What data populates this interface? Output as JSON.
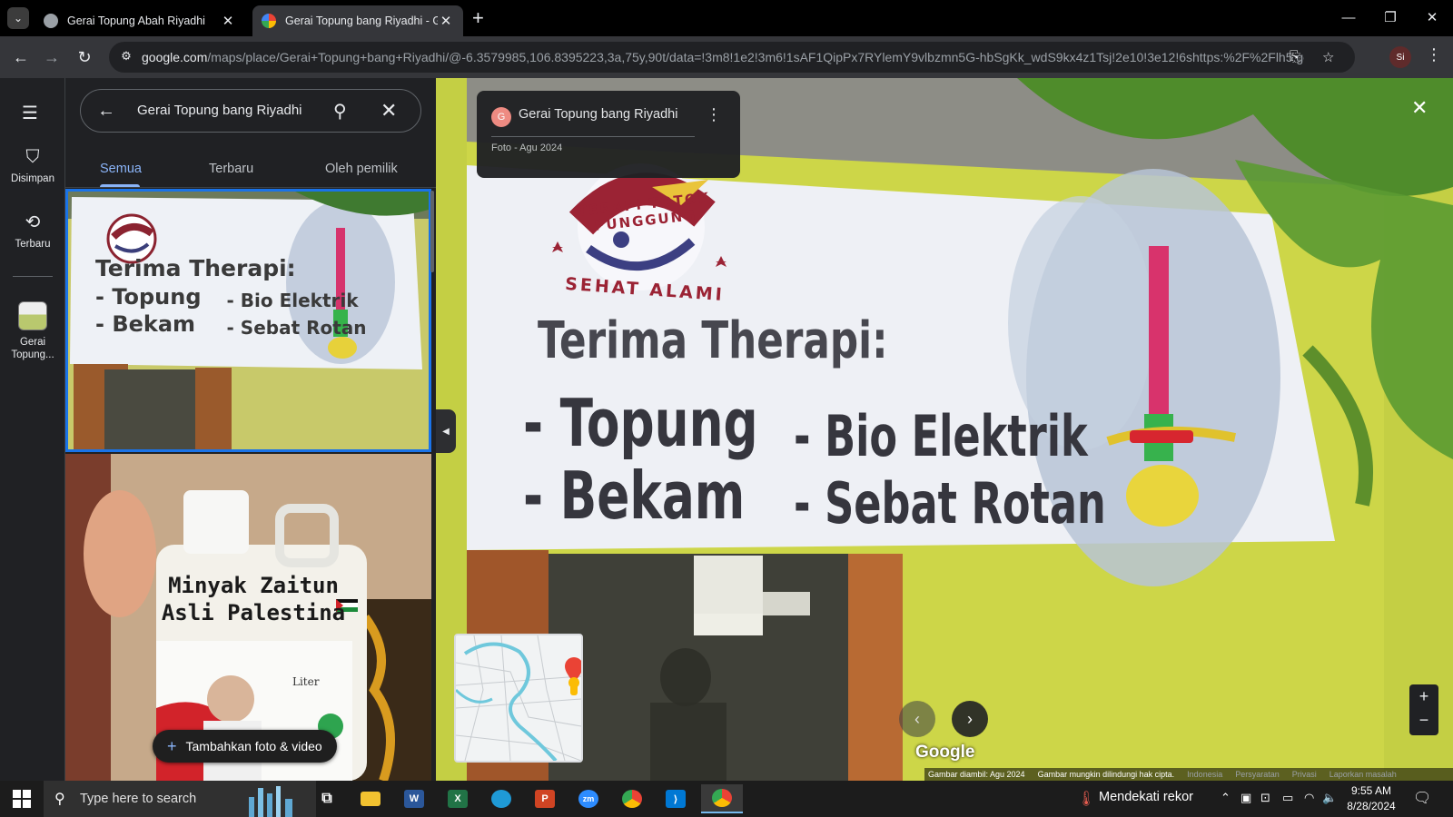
{
  "browser": {
    "tabs": [
      {
        "title": "Gerai Topung Abah Riyadhi",
        "close": "✕"
      },
      {
        "title": "Gerai Topung bang Riyadhi - Go",
        "close": "✕"
      }
    ],
    "new_tab": "+",
    "url_host": "google.com",
    "url_path": "/maps/place/Gerai+Topung+bang+Riyadhi/@-6.3579985,106.8395223,3a,75y,90t/data=!3m8!1e2!3m6!1sAF1QipPx7RYlemY9vlbzmn5G-hbSgKk_wdS9kx4z1Tsj!2e10!3e12!6shttps:%2F%2Flh5.go...",
    "profile": "Si",
    "colors": {
      "tabstrip": "#000000",
      "toolbar": "#35363a",
      "accent": "#8ab4f8"
    }
  },
  "maps": {
    "rail": {
      "menu_icon": "menu-icon",
      "items": [
        {
          "label": "Disimpan",
          "icon": "bookmark-icon"
        },
        {
          "label": "Terbaru",
          "icon": "history-icon"
        },
        {
          "label": "Gerai Topung...",
          "icon": "place-thumbnail"
        }
      ]
    },
    "search": {
      "value": "Gerai Topung bang Riyadhi"
    },
    "tabs": [
      "Semua",
      "Terbaru",
      "Oleh pemilik"
    ],
    "active_tab": "Semua",
    "add_button": "Tambahkan foto & video",
    "photo1_text": {
      "logo_top": "TERAPI TOTOK PUNGGUNG",
      "logo_bottom": "SEHAT ALAMI",
      "heading": "Terima Therapi:",
      "lines": [
        "- Topung",
        "- Bio Elektrik",
        "- Bekam",
        "- Sebat Rotan"
      ]
    },
    "photo2_text": {
      "line1": "Minyak Zaitun",
      "line2": "Asli Palestina",
      "unit": "Liter"
    }
  },
  "viewer": {
    "place_name": "Gerai Topung bang Riyadhi",
    "avatar_letter": "G",
    "meta": "Foto - Agu 2024",
    "banner": {
      "logo_top": "TERAPI TOTOK PUNGGUNG",
      "logo_bottom": "SEHAT ALAMI",
      "heading": "Terima Therapi:",
      "col1": [
        "- Topung",
        "- Bekam"
      ],
      "col2": [
        "- Bio Elektrik",
        "- Sebat Rotan"
      ]
    },
    "google_logo": "Google",
    "footer": {
      "captured": "Gambar diambil: Agu 2024",
      "copyright": "Gambar mungkin dilindungi hak cipta.",
      "links": [
        "Indonesia",
        "Persyaratan",
        "Privasi",
        "Laporkan masalah"
      ]
    }
  },
  "taskbar": {
    "search_placeholder": "Type here to search",
    "weather": "Mendekati rekor",
    "time": "9:55 AM",
    "date": "8/28/2024",
    "apps": [
      "zm"
    ]
  }
}
